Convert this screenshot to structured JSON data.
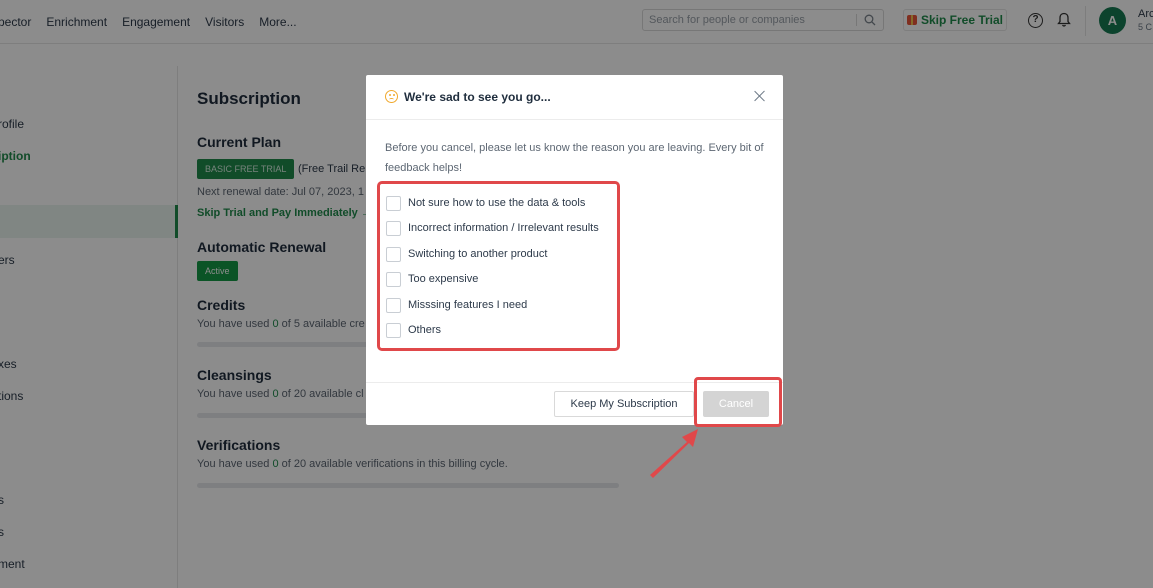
{
  "nav": {
    "items": [
      "pector",
      "Enrichment",
      "Engagement",
      "Visitors",
      "More..."
    ],
    "search_placeholder": "Search for people or companies",
    "skip_trial_label": "Skip Free Trial",
    "avatar_initial": "A",
    "user_name": "Arc",
    "user_sub": "5 C"
  },
  "sidebar": {
    "items": [
      "rofile",
      "iption",
      "ers",
      "xes",
      "tions",
      "s",
      "s",
      "ment"
    ]
  },
  "main": {
    "title": "Subscription",
    "current_plan_heading": "Current Plan",
    "plan_badge": "BASIC FREE TRIAL",
    "plan_extra": "(Free Trail Ren",
    "renewal_text": "Next renewal date: Jul 07, 2023, 1",
    "skip_link": "Skip Trial and Pay Immediately →",
    "auto_renewal_heading": "Automatic Renewal",
    "active_badge": "Active",
    "credits_heading": "Credits",
    "credits_prefix": "You have used ",
    "credits_used": "0",
    "credits_suffix": " of 5 available cre",
    "cleansings_heading": "Cleansings",
    "cleansings_prefix": "You have used ",
    "cleansings_used": "0",
    "cleansings_suffix": " of 20 available cl",
    "verifications_heading": "Verifications",
    "verifications_prefix": "You have used ",
    "verifications_used": "0",
    "verifications_suffix": " of 20 available verifications in this billing cycle."
  },
  "modal": {
    "title": "We're sad to see you go...",
    "intro": "Before you cancel, please let us know the reason you are leaving. Every bit of feedback helps!",
    "reasons": [
      "Not sure how to use the data & tools",
      "Incorrect information / Irrelevant results",
      "Switching to another product",
      "Too expensive",
      "Misssing features I need",
      "Others"
    ],
    "keep_button": "Keep My Subscription",
    "cancel_button": "Cancel"
  },
  "colors": {
    "brand_green": "#1f8a4c",
    "highlight_red": "#e0484a",
    "sad_icon": "#f0a92e"
  }
}
